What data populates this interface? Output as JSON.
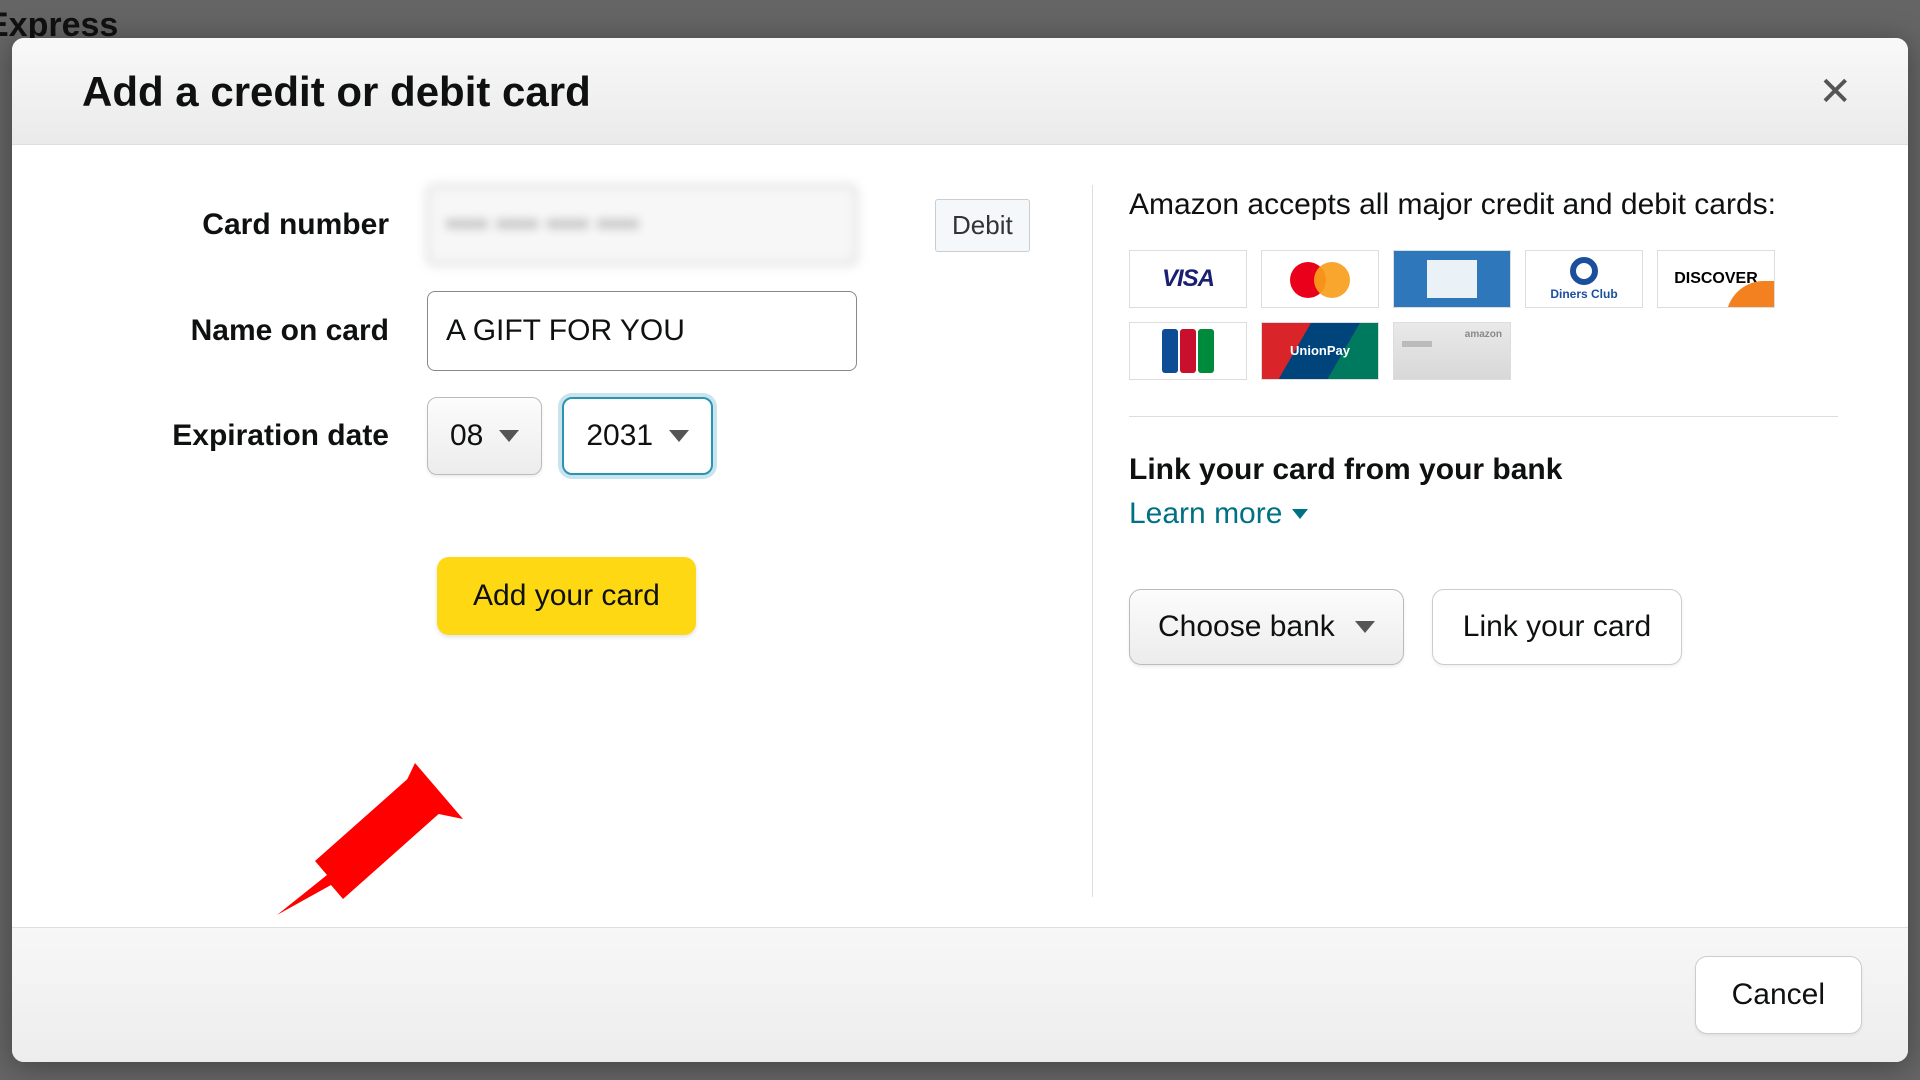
{
  "background": {
    "partial_text": "Express"
  },
  "modal": {
    "title": "Add a credit or debit card",
    "close_aria": "Close"
  },
  "form": {
    "card_number_label": "Card number",
    "card_number_value": "•••• •••• •••• ••••",
    "card_type_badge": "Debit",
    "name_label": "Name on card",
    "name_value": "A GIFT FOR YOU",
    "expiration_label": "Expiration date",
    "expiration_month": "08",
    "expiration_year": "2031",
    "add_card_label": "Add your card"
  },
  "info": {
    "accepted_text": "Amazon accepts all major credit and debit cards:",
    "cards": [
      "Visa",
      "Mastercard",
      "Amex",
      "Diners Club",
      "Discover",
      "JCB",
      "UnionPay",
      "Store Card"
    ],
    "link_heading": "Link your card from your bank",
    "learn_more": "Learn more",
    "choose_bank": "Choose bank",
    "link_card": "Link your card"
  },
  "footer": {
    "cancel": "Cancel"
  }
}
